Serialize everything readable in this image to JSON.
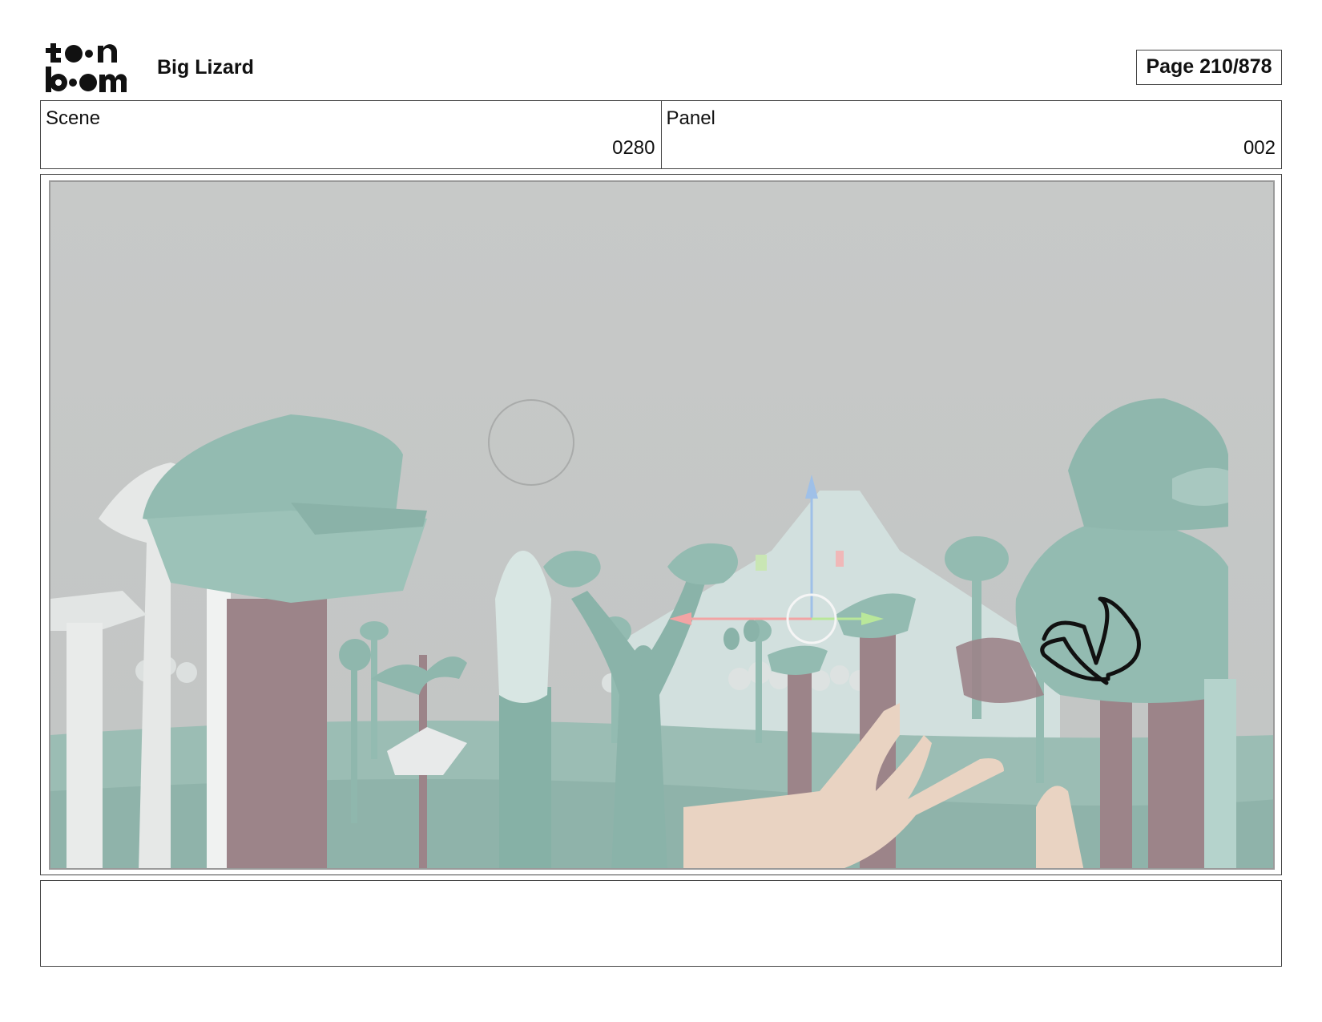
{
  "header": {
    "logo_text": "toon boom",
    "title": "Big Lizard",
    "page_label": "Page 210/878"
  },
  "info": {
    "scene_label": "Scene",
    "scene_value": "0280",
    "panel_label": "Panel",
    "panel_value": "002"
  },
  "notes": {
    "text": ""
  },
  "colors": {
    "sky": "#c5c7c6",
    "foliage": "#8fb7ad",
    "trunk": "#9c8489",
    "pale": "#e2e6e5",
    "hand": "#e9d3c2",
    "border": "#444444"
  }
}
